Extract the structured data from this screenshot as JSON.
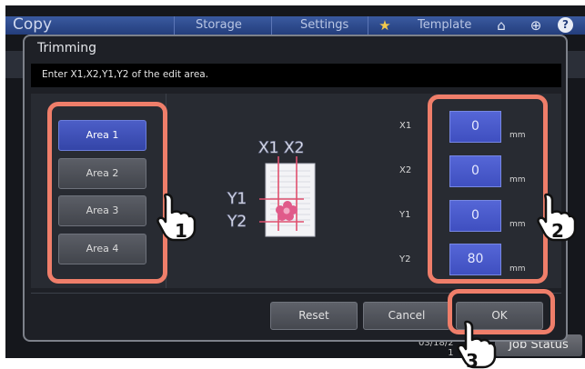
{
  "app": {
    "title": "Copy",
    "tabs": [
      "Storage",
      "Settings",
      "Template"
    ],
    "date_line1": "03/18/2",
    "date_line2": "1",
    "job_status_label": "Job Status",
    "colors": {
      "header": "#2c4a8f",
      "background": "#15171c"
    }
  },
  "dialog": {
    "title": "Trimming",
    "instruction": "Enter X1,X2,Y1,Y2 of the edit area.",
    "areas": [
      {
        "label": "Area 1",
        "selected": true
      },
      {
        "label": "Area 2",
        "selected": false
      },
      {
        "label": "Area 3",
        "selected": false
      },
      {
        "label": "Area 4",
        "selected": false
      }
    ],
    "diagram": {
      "x1": "X1",
      "x2": "X2",
      "y1": "Y1",
      "y2": "Y2"
    },
    "coords": [
      {
        "label": "X1",
        "value": "0",
        "unit": "mm"
      },
      {
        "label": "X2",
        "value": "0",
        "unit": "mm"
      },
      {
        "label": "Y1",
        "value": "0",
        "unit": "mm"
      },
      {
        "label": "Y2",
        "value": "80",
        "unit": "mm"
      }
    ],
    "buttons": {
      "reset": "Reset",
      "cancel": "Cancel",
      "ok": "OK"
    }
  },
  "callouts": {
    "step1": "1",
    "step2": "2",
    "step3": "3",
    "color": "#ef7e6a"
  }
}
